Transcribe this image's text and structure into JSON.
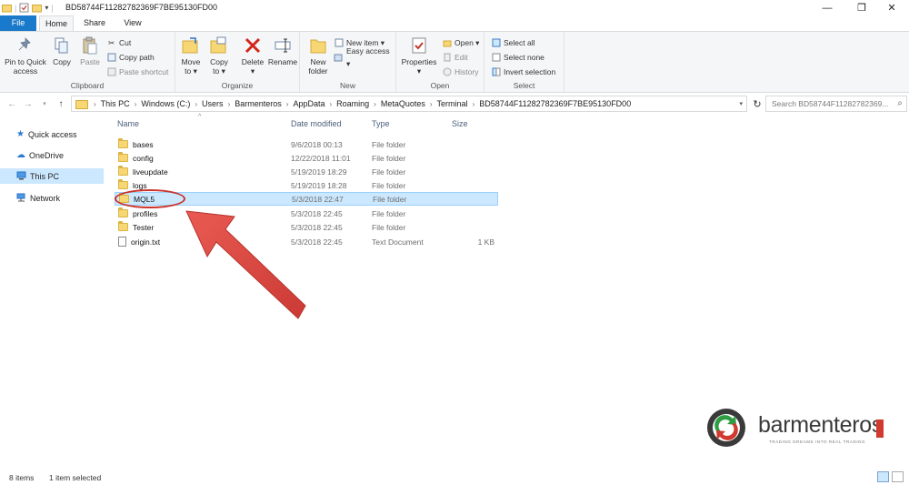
{
  "window": {
    "title": "BD58744F11282782369F7BE95130FD00",
    "minimize": "—",
    "maximize": "❐",
    "close": "✕"
  },
  "tabs": {
    "file": "File",
    "home": "Home",
    "share": "Share",
    "view": "View"
  },
  "ribbon": {
    "clipboard": {
      "label": "Clipboard",
      "pin_line1": "Pin to Quick",
      "pin_line2": "access",
      "copy": "Copy",
      "paste": "Paste",
      "cut": "Cut",
      "copy_path": "Copy path",
      "paste_shortcut": "Paste shortcut"
    },
    "organize": {
      "label": "Organize",
      "move_line1": "Move",
      "move_line2": "to ▾",
      "copy_line1": "Copy",
      "copy_line2": "to ▾",
      "delete_line1": "Delete",
      "delete_line2": "▾",
      "rename": "Rename"
    },
    "new": {
      "label": "New",
      "new_folder_line1": "New",
      "new_folder_line2": "folder",
      "new_item": "New item ▾",
      "easy_access": "Easy access ▾"
    },
    "open": {
      "label": "Open",
      "properties_line1": "Properties",
      "properties_line2": "▾",
      "open": "Open ▾",
      "edit": "Edit",
      "history": "History"
    },
    "select": {
      "label": "Select",
      "select_all": "Select all",
      "select_none": "Select none",
      "invert_selection": "Invert selection"
    }
  },
  "address": {
    "crumbs": [
      "This PC",
      "Windows (C:)",
      "Users",
      "Barmenteros",
      "AppData",
      "Roaming",
      "MetaQuotes",
      "Terminal",
      "BD58744F11282782369F7BE95130FD00"
    ],
    "search_placeholder": "Search BD58744F11282782369..."
  },
  "nav": {
    "quick_access": "Quick access",
    "onedrive": "OneDrive",
    "this_pc": "This PC",
    "network": "Network"
  },
  "columns": {
    "name": "Name",
    "date": "Date modified",
    "type": "Type",
    "size": "Size"
  },
  "files": [
    {
      "name": "bases",
      "date": "9/6/2018 00:13",
      "type": "File folder",
      "size": ""
    },
    {
      "name": "config",
      "date": "12/22/2018 11:01",
      "type": "File folder",
      "size": ""
    },
    {
      "name": "liveupdate",
      "date": "5/19/2019 18:29",
      "type": "File folder",
      "size": ""
    },
    {
      "name": "logs",
      "date": "5/19/2019 18:28",
      "type": "File folder",
      "size": ""
    },
    {
      "name": "MQL5",
      "date": "5/3/2018 22:47",
      "type": "File folder",
      "size": ""
    },
    {
      "name": "profiles",
      "date": "5/3/2018 22:45",
      "type": "File folder",
      "size": ""
    },
    {
      "name": "Tester",
      "date": "5/3/2018 22:45",
      "type": "File folder",
      "size": ""
    },
    {
      "name": "origin.txt",
      "date": "5/3/2018 22:45",
      "type": "Text Document",
      "size": "1 KB"
    }
  ],
  "status": {
    "items": "8 items",
    "selected": "1 item selected"
  },
  "logo": {
    "word": "barmenteros",
    "tagline": "TRADING DREAMS INTO REAL TRADING"
  },
  "colors": {
    "accent": "#1979ca",
    "selection": "#cce8ff",
    "annotation": "#d43a30"
  }
}
